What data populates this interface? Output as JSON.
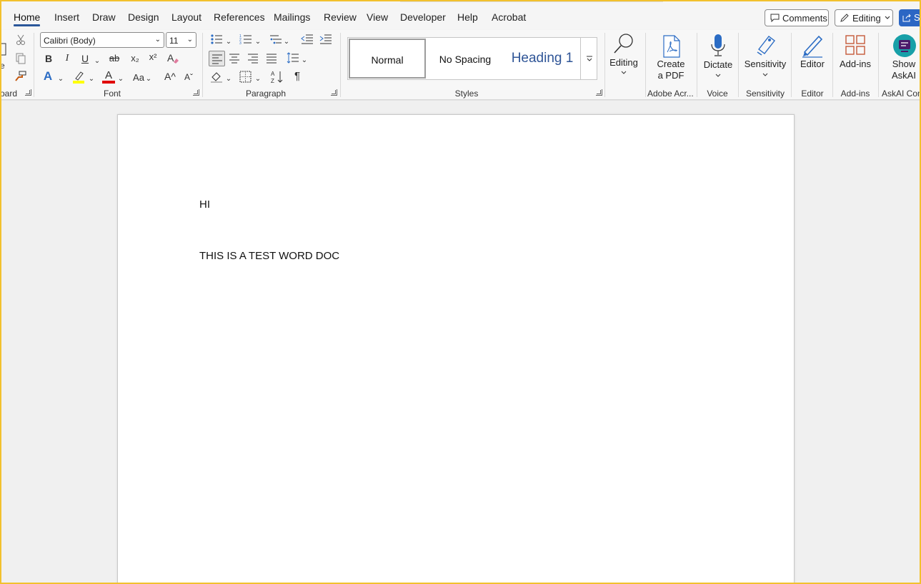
{
  "tabs": [
    "Home",
    "Insert",
    "Draw",
    "Design",
    "Layout",
    "References",
    "Mailings",
    "Review",
    "View",
    "Developer",
    "Help",
    "Acrobat"
  ],
  "active_tab": "Home",
  "header_buttons": {
    "comments": "Comments",
    "editing": "Editing",
    "share": "S"
  },
  "clipboard": {
    "paste_partial": "e",
    "group_label": "oard"
  },
  "font": {
    "name": "Calibri (Body)",
    "size": "11",
    "group_label": "Font",
    "bold": "B",
    "italic": "I",
    "underline": "U",
    "strikethrough": "ab",
    "subscript": "x₂",
    "superscript": "x²",
    "text_effects": "A",
    "font_color": "A",
    "change_case": "Aa",
    "grow_font": "A^",
    "shrink_font": "Aˇ"
  },
  "paragraph": {
    "group_label": "Paragraph",
    "show_marks": "¶"
  },
  "styles": {
    "group_label": "Styles",
    "items": [
      "Normal",
      "No Spacing",
      "Heading 1"
    ],
    "selected": "Normal"
  },
  "editing_group": {
    "label": "Editing"
  },
  "adobe": {
    "button_line1": "Create",
    "button_line2": "a PDF",
    "group_label": "Adobe Acr..."
  },
  "voice": {
    "button": "Dictate",
    "group_label": "Voice"
  },
  "sensitivity": {
    "button": "Sensitivity",
    "group_label": "Sensitivity"
  },
  "editor": {
    "button": "Editor",
    "group_label": "Editor"
  },
  "addins": {
    "button": "Add-ins",
    "group_label": "Add-ins"
  },
  "askai": {
    "button_line1": "Show",
    "button_line2": "AskAI",
    "group_label": "AskAI Com"
  },
  "document": {
    "paragraphs": [
      "HI",
      "THIS IS A TEST WORD DOC"
    ]
  },
  "colors": {
    "accent": "#2b579a",
    "highlight": "#ffff00",
    "font_color": "#e00000",
    "heading": "#2f5597",
    "frame": "#f2c12e"
  }
}
